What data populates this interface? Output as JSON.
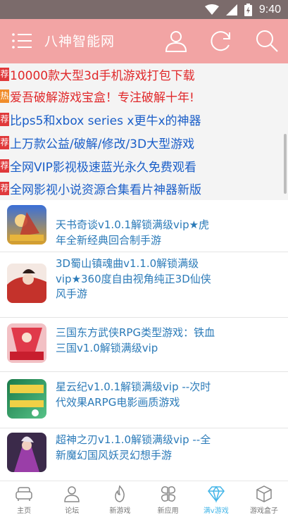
{
  "statusbar": {
    "time": "9:40"
  },
  "appbar": {
    "title": "八神智能网"
  },
  "promos": [
    {
      "tag": "荐",
      "tag_type": "t",
      "text": "10000款大型3d手机游戏打包下载",
      "color": "#e0282a"
    },
    {
      "tag": "热",
      "tag_type": "h",
      "text": "爱吾破解游戏宝盒！专注破解十年!",
      "color": "#e0282a"
    },
    {
      "tag": "荐",
      "tag_type": "t",
      "text": "比ps5和xbox series x更牛x的神器",
      "color": "#1a5ec8"
    },
    {
      "tag": "荐",
      "tag_type": "t",
      "text": "上万款公益/破解/修改/3D大型游戏",
      "color": "#1a5ec8"
    },
    {
      "tag": "荐",
      "tag_type": "t",
      "text": "全网VIP影视极速蓝光永久免费观看",
      "color": "#1a5ec8"
    },
    {
      "tag": "荐",
      "tag_type": "t",
      "text": "全网影视小说资源合集看片神器新版",
      "color": "#1a5ec8"
    }
  ],
  "games": [
    {
      "name": "天书奇谈v1.0.1解锁满级vip★虎年全新经典回合制手游"
    },
    {
      "name": "3D蜀山镇魂曲v1.1.0解锁满级vip★360度自由视角纯正3D仙侠风手游"
    },
    {
      "name": "三国东方武侠RPG类型游戏：铁血三国v1.0解锁满级vip"
    },
    {
      "name": "星云纪v1.0.1解锁满级vip --次时代效果ARPG电影画质游戏"
    },
    {
      "name": "超神之刃v1.1.0解锁满级vip --全新魔幻国风妖灵幻想手游"
    }
  ],
  "tabs": [
    {
      "label": "主页",
      "icon": "sofa-icon"
    },
    {
      "label": "论坛",
      "icon": "user-icon"
    },
    {
      "label": "新游戏",
      "icon": "flame-icon"
    },
    {
      "label": "新应用",
      "icon": "clover-icon"
    },
    {
      "label": "满v游戏",
      "icon": "diamond-icon",
      "active": true
    },
    {
      "label": "游戏盒子",
      "icon": "cube-icon"
    }
  ],
  "colors": {
    "appbar": "#f2a4a4",
    "statusbar": "#7b6b6b",
    "active_tab": "#45b6e8",
    "link": "#2a7ab8"
  }
}
